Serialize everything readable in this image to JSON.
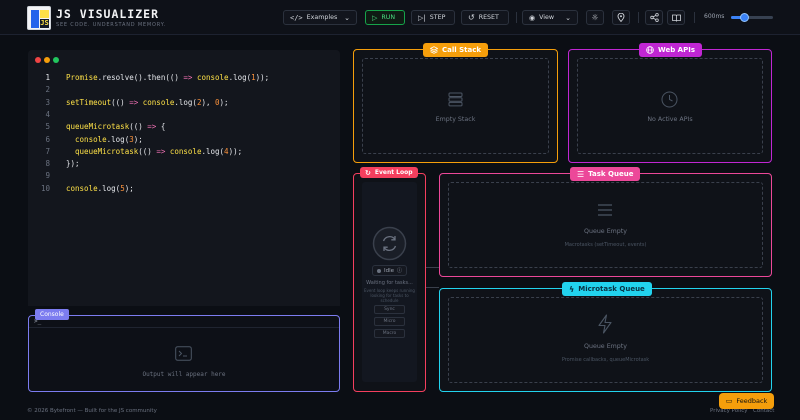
{
  "app": {
    "title": "JS VISUALIZER",
    "subtitle": "SEE CODE. UNDERSTAND MEMORY.",
    "logo_glyph": "JS"
  },
  "toolbar": {
    "examples_label": "Examples",
    "run_label": "RUN",
    "step_label": "STEP",
    "reset_label": "RESET",
    "view_label": "View",
    "speed_label": "600ms",
    "speed_fraction": 0.3
  },
  "editor": {
    "lines": [
      {
        "num": "1",
        "text": "Promise.resolve().then(() => console.log(1));"
      },
      {
        "num": "2",
        "text": ""
      },
      {
        "num": "3",
        "text": "setTimeout(() => console.log(2), 0);"
      },
      {
        "num": "4",
        "text": ""
      },
      {
        "num": "5",
        "text": "queueMicrotask(() => {"
      },
      {
        "num": "6",
        "text": "  console.log(3);"
      },
      {
        "num": "7",
        "text": "  queueMicrotask(() => console.log(4));"
      },
      {
        "num": "8",
        "text": "});"
      },
      {
        "num": "9",
        "text": ""
      },
      {
        "num": "10",
        "text": "console.log(5);"
      }
    ]
  },
  "console": {
    "tag": "Console",
    "prompt": ">_",
    "placeholder": "Output will appear here"
  },
  "call_stack": {
    "tag": "Call Stack",
    "empty": "Empty Stack"
  },
  "web_apis": {
    "tag": "Web APIs",
    "empty": "No Active APIs"
  },
  "event_loop": {
    "tag": "Event Loop",
    "status": "Idle",
    "waiting": "Waiting for tasks...",
    "hint": "Event loop keeps running looking for tasks to schedule",
    "chips": [
      "Sync",
      "Micro",
      "Macro"
    ]
  },
  "task_queue": {
    "tag": "Task Queue",
    "empty": "Queue Empty",
    "hint": "Macrotasks (setTimeout, events)"
  },
  "microtask_queue": {
    "tag": "Microtask Queue",
    "empty": "Queue Empty",
    "hint": "Promise callbacks, queueMicrotask"
  },
  "footer": {
    "copyright": "© 2026 Bytefront — Built for the JS community",
    "privacy": "Privacy Policy",
    "contact": "Contact",
    "feedback": "Feedback"
  },
  "colors": {
    "call_stack": "#f59e0b",
    "web_apis": "#c026d3",
    "event_loop": "#f43f5e",
    "task_queue": "#ec4899",
    "microtask_queue": "#22d3ee",
    "console": "#7c7cf0",
    "run": "#16a34a"
  }
}
